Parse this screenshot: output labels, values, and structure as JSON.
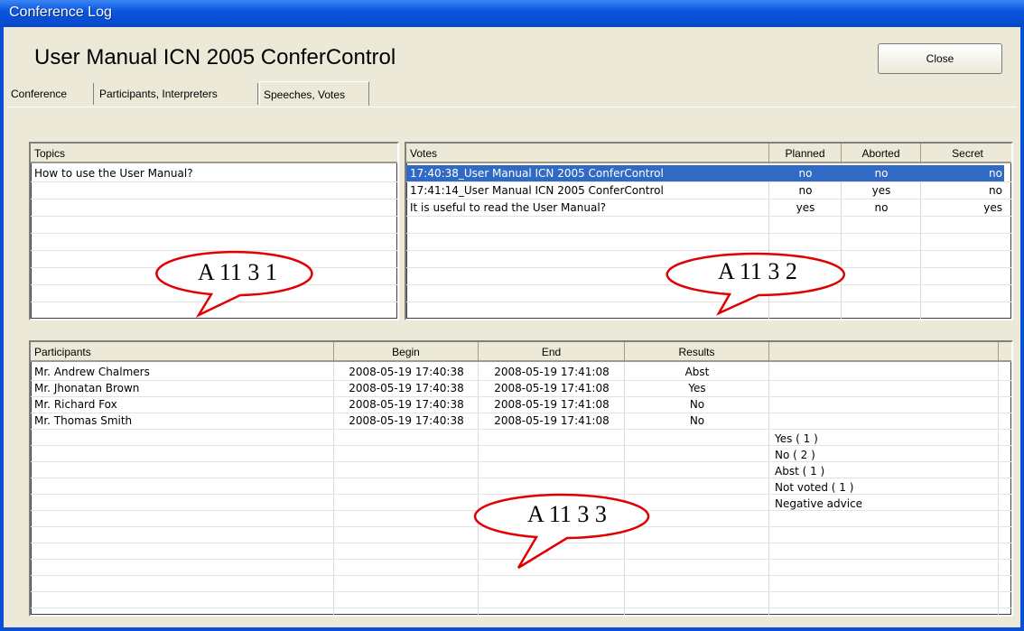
{
  "window": {
    "title": "Conference Log"
  },
  "header": {
    "doc_title": "User Manual ICN 2005 ConferControl",
    "close_label": "Close"
  },
  "tabs": [
    {
      "label": "Conference",
      "active": false
    },
    {
      "label": "Participants, Interpreters",
      "active": false
    },
    {
      "label": "Speeches, Votes",
      "active": true
    }
  ],
  "topics": {
    "header": "Topics",
    "rows": [
      "How to use the User Manual?"
    ]
  },
  "votes": {
    "headers": {
      "votes": "Votes",
      "planned": "Planned",
      "aborted": "Aborted",
      "secret": "Secret"
    },
    "rows": [
      {
        "vote": "17:40:38_User Manual ICN 2005 ConferControl",
        "planned": "no",
        "aborted": "no",
        "secret": "no",
        "selected": true
      },
      {
        "vote": "17:41:14_User Manual ICN 2005 ConferControl",
        "planned": "no",
        "aborted": "yes",
        "secret": "no",
        "selected": false
      },
      {
        "vote": "It is useful to read the User Manual?",
        "planned": "yes",
        "aborted": "no",
        "secret": "yes",
        "selected": false
      }
    ]
  },
  "participants": {
    "headers": {
      "participants": "Participants",
      "begin": "Begin",
      "end": "End",
      "results": "Results",
      "extra": ""
    },
    "rows": [
      {
        "name": "Mr. Andrew Chalmers",
        "begin": "2008-05-19 17:40:38",
        "end": "2008-05-19 17:41:08",
        "result": "Abst"
      },
      {
        "name": "Mr. Jhonatan Brown",
        "begin": "2008-05-19 17:40:38",
        "end": "2008-05-19 17:41:08",
        "result": "Yes"
      },
      {
        "name": "Mr. Richard Fox",
        "begin": "2008-05-19 17:40:38",
        "end": "2008-05-19 17:41:08",
        "result": "No"
      },
      {
        "name": "Mr. Thomas Smith",
        "begin": "2008-05-19 17:40:38",
        "end": "2008-05-19 17:41:08",
        "result": "No"
      }
    ],
    "summary": [
      "Yes ( 1 )",
      "No ( 2 )",
      "Abst ( 1 )",
      "Not voted ( 1 )",
      "Negative advice"
    ]
  },
  "callouts": [
    "A 11 3 1",
    "A 11 3 2",
    "A 11 3 3"
  ],
  "colors": {
    "title_bar": "#0a56e0",
    "selection": "#316ac5",
    "window_bg": "#ece9d8",
    "callout": "#e00000"
  }
}
